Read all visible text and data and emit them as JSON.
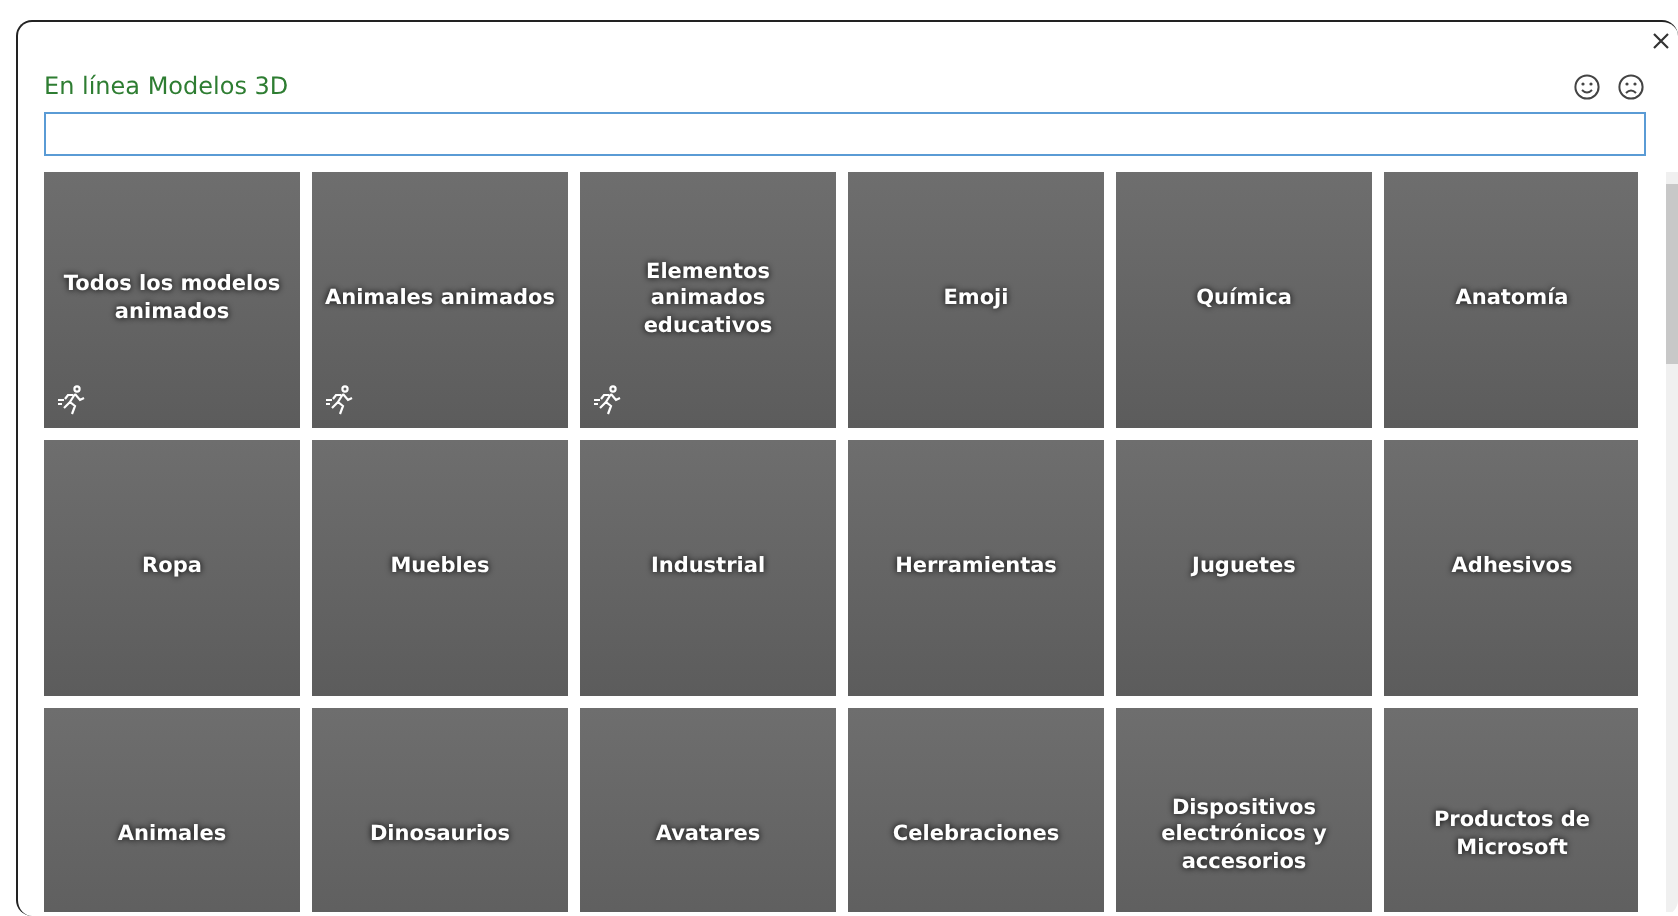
{
  "dialog": {
    "title": "En línea Modelos 3D"
  },
  "tiles": [
    {
      "label": "Todos los modelos animados",
      "animated": true
    },
    {
      "label": "Animales animados",
      "animated": true
    },
    {
      "label": "Elementos animados educativos",
      "animated": true
    },
    {
      "label": "Emoji",
      "animated": false
    },
    {
      "label": "Química",
      "animated": false
    },
    {
      "label": "Anatomía",
      "animated": false
    },
    {
      "label": "Ropa",
      "animated": false
    },
    {
      "label": "Muebles",
      "animated": false
    },
    {
      "label": "Industrial",
      "animated": false
    },
    {
      "label": "Herramientas",
      "animated": false
    },
    {
      "label": "Juguetes",
      "animated": false
    },
    {
      "label": "Adhesivos",
      "animated": false
    },
    {
      "label": "Animales"
    },
    {
      "label": "Dinosaurios"
    },
    {
      "label": "Avatares"
    },
    {
      "label": "Celebraciones"
    },
    {
      "label": "Dispositivos electrónicos y accesorios"
    },
    {
      "label": "Productos de Microsoft"
    }
  ]
}
